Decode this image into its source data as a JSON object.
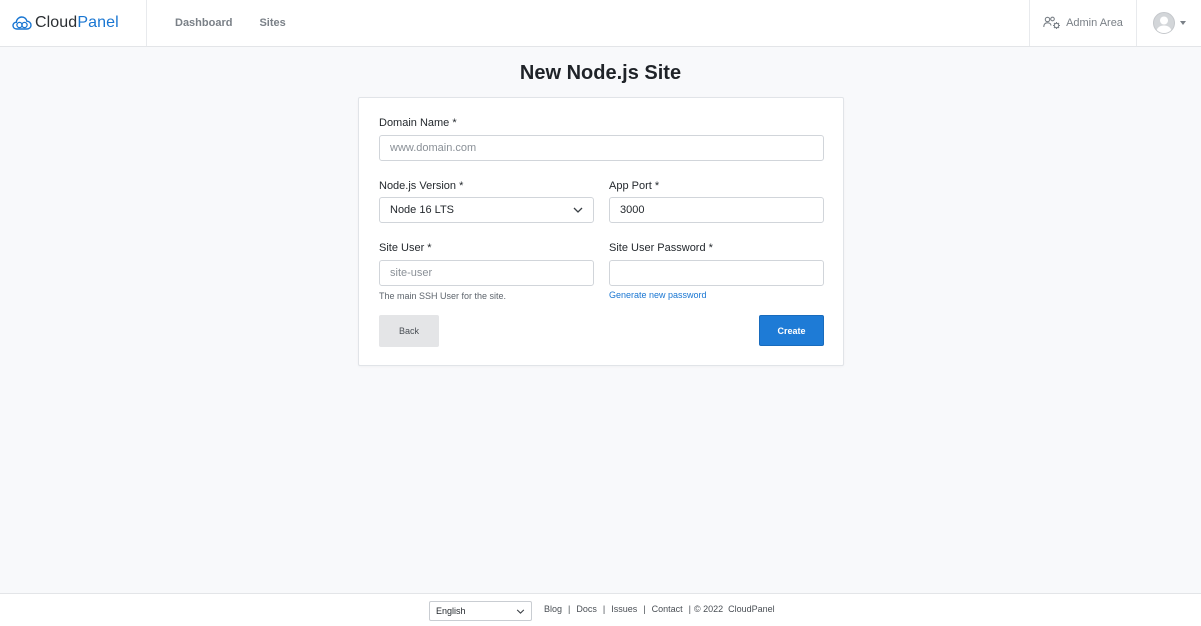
{
  "header": {
    "brand_cloud": "Cloud",
    "brand_panel": "Panel",
    "nav": [
      {
        "label": "Dashboard"
      },
      {
        "label": "Sites"
      }
    ],
    "admin_area_label": "Admin Area"
  },
  "page": {
    "title": "New Node.js Site"
  },
  "form": {
    "domain_name": {
      "label": "Domain Name *",
      "placeholder": "www.domain.com",
      "value": ""
    },
    "nodejs_version": {
      "label": "Node.js Version *",
      "value": "Node 16 LTS"
    },
    "app_port": {
      "label": "App Port *",
      "value": "3000"
    },
    "site_user": {
      "label": "Site User *",
      "placeholder": "site-user",
      "value": "",
      "help": "The main SSH User for the site."
    },
    "site_user_password": {
      "label": "Site User Password *",
      "value": "",
      "generate_link": "Generate new password"
    },
    "back_label": "Back",
    "create_label": "Create"
  },
  "footer": {
    "language": "English",
    "links": [
      "Blog",
      "Docs",
      "Issues",
      "Contact"
    ],
    "copyright": "© 2022  CloudPanel"
  },
  "colors": {
    "accent": "#1976d2",
    "primary_button": "#1e7bd6",
    "background": "#f8f9fb"
  }
}
